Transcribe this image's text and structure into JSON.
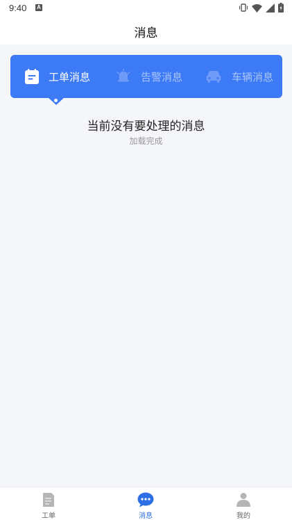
{
  "status": {
    "time": "9:40",
    "notif": "A"
  },
  "header": {
    "title": "消息"
  },
  "tabs": [
    {
      "label": "工单消息",
      "active": true
    },
    {
      "label": "告警消息",
      "active": false
    },
    {
      "label": "车辆消息",
      "active": false
    }
  ],
  "empty": {
    "title": "当前没有要处理的消息",
    "subtitle": "加载完成"
  },
  "bottom_nav": [
    {
      "label": "工单",
      "active": false
    },
    {
      "label": "消息",
      "active": true
    },
    {
      "label": "我的",
      "active": false
    }
  ],
  "colors": {
    "accent": "#3d7af5",
    "active_nav": "#2f6fe6",
    "background": "#f5f6fa"
  }
}
